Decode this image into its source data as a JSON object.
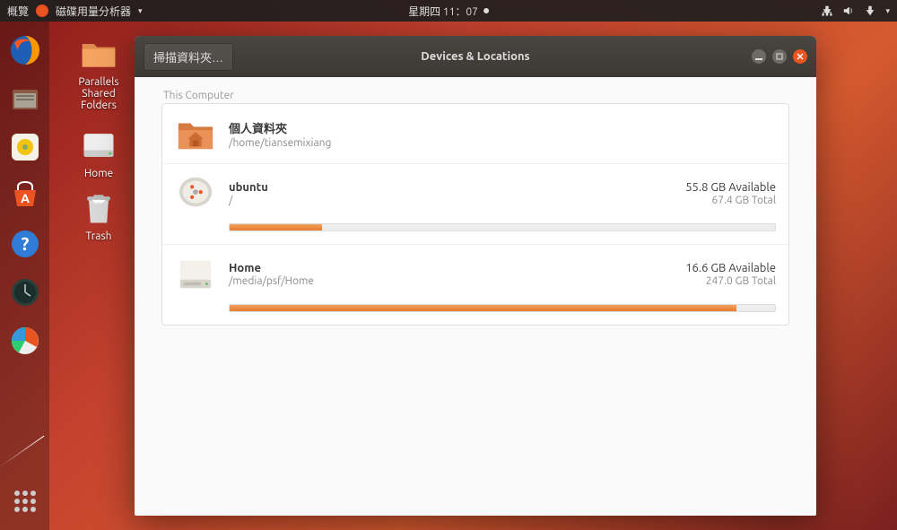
{
  "topbar": {
    "activities": "概覽",
    "app_name": "磁碟用量分析器",
    "datetime": "星期四 11：07"
  },
  "desktop": {
    "parallels_folder": "Parallels Shared Folders",
    "home": "Home",
    "trash": "Trash"
  },
  "window": {
    "scan_button": "掃描資料夾…",
    "title": "Devices & Locations",
    "section": "This Computer",
    "items": [
      {
        "title": "個人資料夾",
        "path": "/home/tiansemixiang",
        "available": "",
        "total": "",
        "progress_pct": null
      },
      {
        "title": "ubuntu",
        "path": "/",
        "available": "55.8 GB Available",
        "total": "67.4 GB Total",
        "progress_pct": 17
      },
      {
        "title": "Home",
        "path": "/media/psf/Home",
        "available": "16.6 GB Available",
        "total": "247.0 GB Total",
        "progress_pct": 93
      }
    ]
  }
}
